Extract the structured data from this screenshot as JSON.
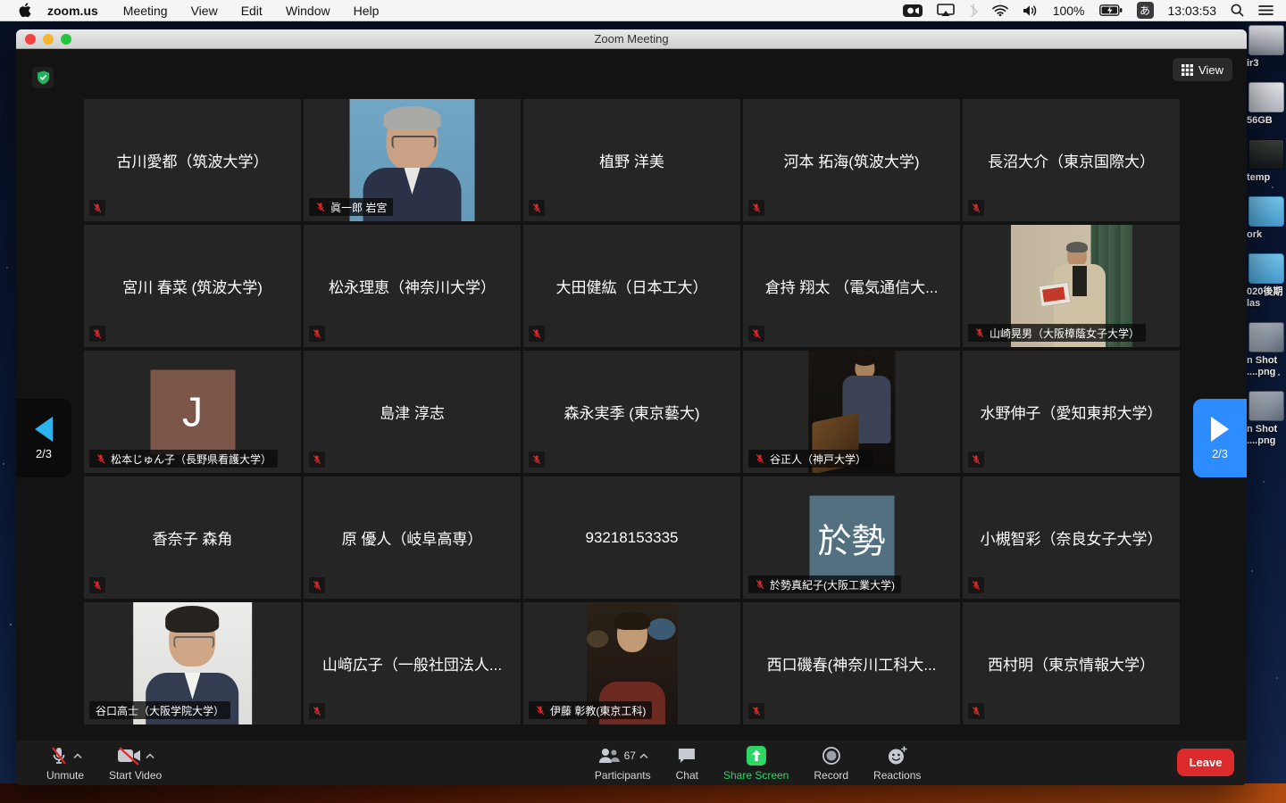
{
  "menu_bar": {
    "apple_icon": "apple-logo",
    "items": [
      "zoom.us",
      "Meeting",
      "View",
      "Edit",
      "Window",
      "Help"
    ],
    "status": {
      "icons": [
        "zoom-camera-icon",
        "screen-mirroring-icon",
        "bluetooth-icon",
        "wifi-icon",
        "volume-icon",
        "battery-charging-icon",
        "input-source-icon",
        "spotlight-icon",
        "notification-center-icon"
      ],
      "battery": "100%",
      "input_source": "あ",
      "time": "13:03:53"
    }
  },
  "window": {
    "title": "Zoom Meeting",
    "view_button": "View"
  },
  "pagination": {
    "left": "2/3",
    "right": "2/3"
  },
  "participants": [
    {
      "type": "name",
      "name": "古川愛都（筑波大学）",
      "muted": true
    },
    {
      "type": "video",
      "video": "iwamiya",
      "label": "眞一郎 岩宮",
      "muted": true
    },
    {
      "type": "name",
      "name": "植野 洋美",
      "muted": true
    },
    {
      "type": "name",
      "name": "河本 拓海(筑波大学)",
      "muted": true
    },
    {
      "type": "name",
      "name": "長沼大介（東京国際大）",
      "muted": true
    },
    {
      "type": "name",
      "name": "宮川 春菜 (筑波大学)",
      "muted": true
    },
    {
      "type": "name",
      "name": "松永理恵（神奈川大学）",
      "muted": true
    },
    {
      "type": "name",
      "name": "大田健紘（日本工大）",
      "muted": true
    },
    {
      "type": "name",
      "name": "倉持 翔太 （電気通信大...",
      "muted": true
    },
    {
      "type": "video",
      "video": "yamazaki",
      "label": "山崎晃男（大阪樟蔭女子大学）",
      "muted": true
    },
    {
      "type": "avatar",
      "initial": "J",
      "color": "#7d564a",
      "label": "松本じゅん子（長野県看護大学）",
      "muted": true
    },
    {
      "type": "name",
      "name": "島津 淳志",
      "muted": true
    },
    {
      "type": "name",
      "name": "森永実季 (東京藝大)",
      "muted": true
    },
    {
      "type": "video",
      "video": "tani",
      "label": "谷正人（神戸大学）",
      "muted": true
    },
    {
      "type": "name",
      "name": "水野伸子（愛知東邦大学）",
      "muted": true
    },
    {
      "type": "name",
      "name": "香奈子 森角",
      "muted": true
    },
    {
      "type": "name",
      "name": "原 優人（岐阜高専）",
      "muted": true
    },
    {
      "type": "name",
      "name": "93218153335",
      "muted": false
    },
    {
      "type": "avatar",
      "initial": "於勢",
      "color": "#52707f",
      "label": "於勢真紀子(大阪工業大学)",
      "muted": true
    },
    {
      "type": "name",
      "name": "小槻智彩（奈良女子大学）",
      "muted": true
    },
    {
      "type": "video",
      "video": "taniguchi",
      "label": "谷口高士（大阪学院大学）",
      "muted": false
    },
    {
      "type": "name",
      "name": "山﨑広子（一般社団法人...",
      "muted": true
    },
    {
      "type": "video",
      "video": "ito",
      "label": "伊藤 彰教(東京工科)",
      "muted": true
    },
    {
      "type": "name",
      "name": "西口磯春(神奈川工科大...",
      "muted": true
    },
    {
      "type": "name",
      "name": "西村明（東京情報大学）",
      "muted": true
    }
  ],
  "toolbar": {
    "unmute": "Unmute",
    "start_video": "Start Video",
    "participants": "Participants",
    "participants_count": "67",
    "chat": "Chat",
    "share_screen": "Share Screen",
    "record": "Record",
    "reactions": "Reactions",
    "leave": "Leave"
  },
  "desktop_icons": [
    {
      "kind": "drive",
      "label": "ir3"
    },
    {
      "kind": "card",
      "label": "56GB"
    },
    {
      "kind": "dark",
      "label": "temp"
    },
    {
      "kind": "folder",
      "label": "ork"
    },
    {
      "kind": "folder",
      "label": "020後期\nlas"
    },
    {
      "kind": "shot",
      "label": "n Shot\n....png"
    },
    {
      "kind": "shot",
      "label": "n Shot\n....png"
    }
  ],
  "colors": {
    "accent_blue": "#2d8cff",
    "mute_red": "#e02828",
    "share_green": "#2fd565",
    "leave_red": "#dd2a2a"
  }
}
